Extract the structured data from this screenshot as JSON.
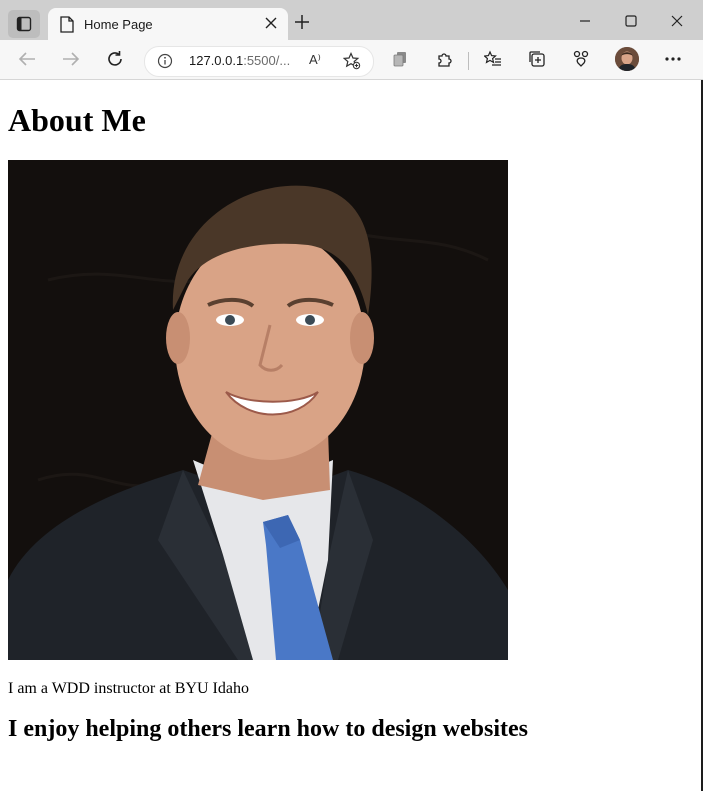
{
  "browser": {
    "tab": {
      "title": "Home Page"
    },
    "address": {
      "host": "127.0.0.1",
      "rest": ":5500/...",
      "read_aloud": "A⁾"
    }
  },
  "page": {
    "heading": "About Me",
    "paragraph": "I am a WDD instructor at BYU Idaho",
    "subheading": "I enjoy helping others learn how to design websites"
  },
  "colors": {
    "titlebar": "#cfcfcf",
    "toolbar": "#f7f7f7",
    "photo_bg": "#130f0d",
    "suit": "#1f2329",
    "tie": "#4a78c7",
    "skin": "#d9a386"
  }
}
